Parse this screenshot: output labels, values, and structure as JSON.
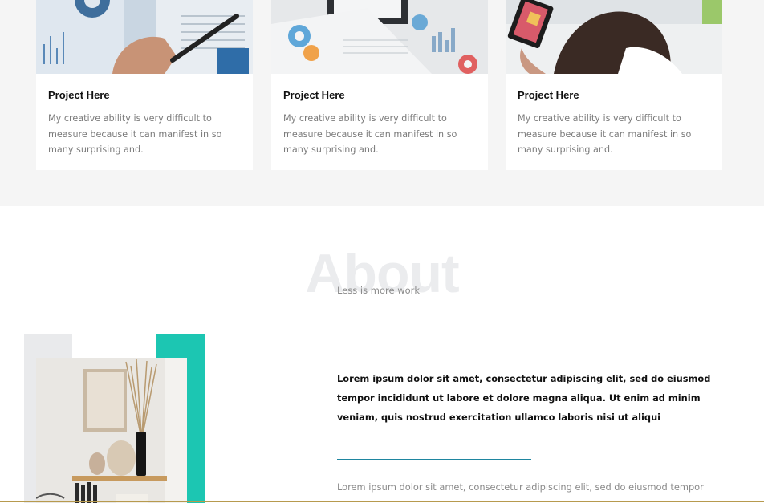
{
  "projects": {
    "cards": [
      {
        "title": "Project Here",
        "description": "My creative ability is very difficult to measure because it can manifest in so many surprising and.",
        "image": "finance-chart-photo"
      },
      {
        "title": "Project Here",
        "description": "My creative ability is very difficult to measure because it can manifest in so many surprising and.",
        "image": "desk-reports-photo"
      },
      {
        "title": "Project Here",
        "description": "My creative ability is very difficult to measure because it can manifest in so many surprising and.",
        "image": "woman-tablet-photo"
      }
    ]
  },
  "about": {
    "title": "About",
    "subtitle": "Less is more work",
    "lead": "Lorem ipsum dolor sit amet, consectetur adipiscing elit, sed do eiusmod tempor incididunt ut labore et dolore magna aliqua. Ut enim ad minim veniam, quis nostrud exercitation ullamco laboris nisi ut aliqui",
    "body": "Lorem ipsum dolor sit amet, consectetur adipiscing elit, sed do eiusmod tempor",
    "image": "shelf-decor-photo"
  },
  "colors": {
    "accent_teal": "#1cc6b2",
    "divider_blue": "#1f86a0",
    "section_grey": "#f5f5f5",
    "bottom_line_gold": "#b79a4e"
  }
}
